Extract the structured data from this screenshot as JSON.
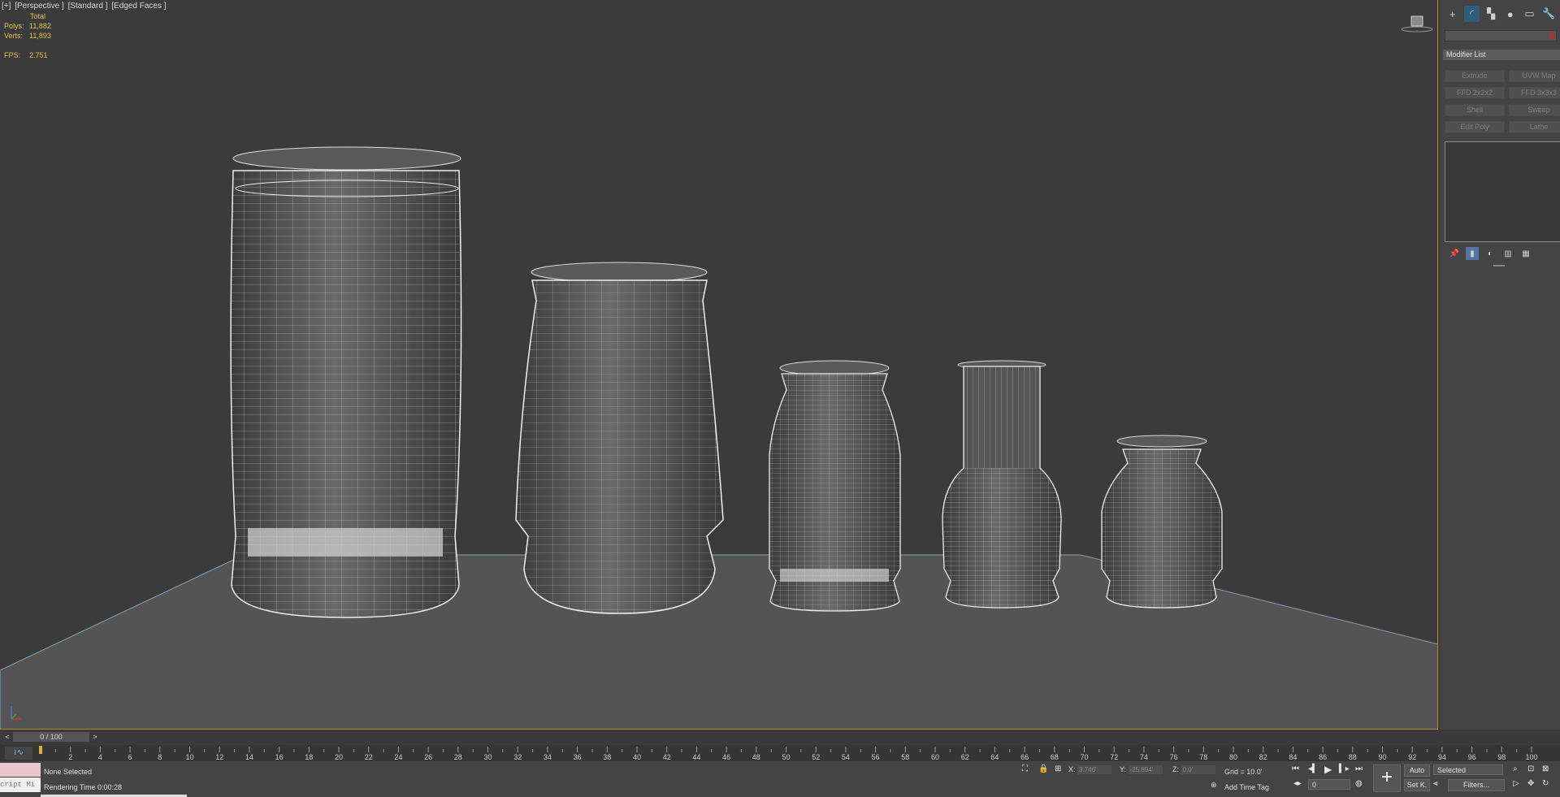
{
  "viewport": {
    "label_parts": [
      "[+]",
      "[Perspective ]",
      "[Standard ]",
      "[Edged Faces ]"
    ],
    "stats": {
      "total_label": "Total",
      "polys_label": "Polys:",
      "polys_value": "11,882",
      "verts_label": "Verts:",
      "verts_value": "11,893",
      "fps_label": "FPS:",
      "fps_value": "2.751"
    }
  },
  "command_panel": {
    "tabs": [
      {
        "icon": "plus-icon",
        "glyph": "+"
      },
      {
        "icon": "modify-icon",
        "glyph": "◜"
      },
      {
        "icon": "hierarchy-icon",
        "glyph": "▚"
      },
      {
        "icon": "motion-icon",
        "glyph": "●"
      },
      {
        "icon": "display-icon",
        "glyph": "▭"
      },
      {
        "icon": "utilities-icon",
        "glyph": "🔧"
      }
    ],
    "modifier_list_label": "Modifier List",
    "modifier_buttons": [
      "Extrude",
      "UVW Map",
      "FFD 2x2x2",
      "FFD 3x3x3",
      "Shell",
      "Sweep",
      "Edit Poly",
      "Lathe"
    ]
  },
  "timeline": {
    "frame_display": "0 / 100",
    "prev": "<",
    "next": ">",
    "tick_labels": [
      "2",
      "4",
      "6",
      "8",
      "10",
      "12",
      "14",
      "16",
      "18",
      "20",
      "22",
      "24",
      "26",
      "28",
      "30",
      "32",
      "34",
      "36",
      "38",
      "40",
      "42",
      "44",
      "46",
      "48",
      "50",
      "52",
      "54",
      "56",
      "58",
      "60",
      "62",
      "64",
      "66",
      "68",
      "70",
      "72",
      "74",
      "76",
      "78",
      "80",
      "82",
      "84",
      "86",
      "88",
      "90",
      "92",
      "94",
      "96",
      "98",
      "100"
    ]
  },
  "status": {
    "selection": "None Selected",
    "render_time": "Rendering Time  0:00:28",
    "listener_text": "cript Mi",
    "x_label": "X:",
    "x_value": "3.746'",
    "y_label": "Y:",
    "y_value": "-25.894'",
    "z_label": "Z:",
    "z_value": "0.0'",
    "grid": "Grid = 10.0'",
    "add_time_tag": "Add Time Tag",
    "auto": "Auto",
    "set_key": "Set K.",
    "selected": "Selected",
    "filters": "Filters...",
    "frame_value": "0"
  },
  "colors": {
    "accent_border": "#b08a2a",
    "stats_text": "#e3c44a",
    "viewport_bg": "#3b3b3b"
  }
}
